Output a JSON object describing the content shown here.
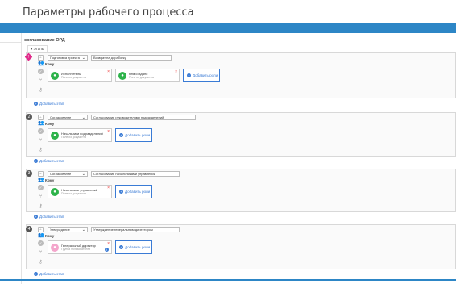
{
  "page": {
    "title": "Параметры рабочего процесса"
  },
  "process": {
    "name": "согласование ОРД",
    "stages_tab": "Этапы"
  },
  "to_label": "Кому",
  "add_role_label": "Добавить роли",
  "add_stage_label": "Добавить этап",
  "stages": [
    {
      "badge": "!",
      "type": "Подготовка проекта",
      "name": "Возврат на доработку",
      "roles": [
        {
          "title": "Исполнитель",
          "sub": "Поле из документа"
        },
        {
          "title": "Кем создано",
          "sub": "Поле из документа"
        }
      ]
    },
    {
      "badge": "2",
      "type": "Согласование",
      "name": "Согласование руководителями подразделений",
      "roles": [
        {
          "title": "Начальники подразделений",
          "sub": "Поле из документа"
        }
      ]
    },
    {
      "badge": "3",
      "type": "Согласование",
      "name": "Согласование начальниками управлений",
      "roles": [
        {
          "title": "Начальники управлений",
          "sub": "Поле из документа"
        }
      ]
    },
    {
      "badge": "4",
      "type": "Утверждение",
      "name": "Утверждение генеральным директором",
      "roles": [
        {
          "title": "Генеральный директор",
          "sub": "Группа пользователей"
        }
      ]
    }
  ],
  "colors": {
    "accent": "#2d86c6",
    "role_green": "#2db34a",
    "link_blue": "#3a7bd5",
    "badge_pink": "#e02b8a"
  }
}
